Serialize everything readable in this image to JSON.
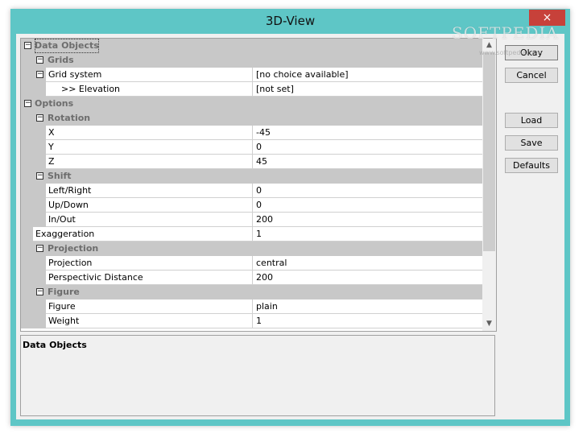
{
  "window": {
    "title": "3D-View",
    "close_icon": "×"
  },
  "grid": {
    "rows": [
      {
        "kind": "cat",
        "level": 0,
        "label": "Data Objects",
        "selected": true
      },
      {
        "kind": "cat",
        "level": 1,
        "label": "Grids"
      },
      {
        "kind": "prop",
        "level": 1,
        "expander": true,
        "name": "Grid system",
        "value": "[no choice available]"
      },
      {
        "kind": "prop",
        "level": 2,
        "name": ">> Elevation",
        "value": "[not set]"
      },
      {
        "kind": "cat",
        "level": 0,
        "label": "Options"
      },
      {
        "kind": "cat",
        "level": 1,
        "label": "Rotation"
      },
      {
        "kind": "prop",
        "level": 1,
        "name": "X",
        "value": "-45"
      },
      {
        "kind": "prop",
        "level": 1,
        "name": "Y",
        "value": "0"
      },
      {
        "kind": "prop",
        "level": 1,
        "name": "Z",
        "value": "45"
      },
      {
        "kind": "cat",
        "level": 1,
        "label": "Shift"
      },
      {
        "kind": "prop",
        "level": 1,
        "name": "Left/Right",
        "value": "0"
      },
      {
        "kind": "prop",
        "level": 1,
        "name": "Up/Down",
        "value": "0"
      },
      {
        "kind": "prop",
        "level": 1,
        "name": "In/Out",
        "value": "200"
      },
      {
        "kind": "prop",
        "level": 0,
        "name": "Exaggeration",
        "value": "1"
      },
      {
        "kind": "cat",
        "level": 1,
        "label": "Projection"
      },
      {
        "kind": "prop",
        "level": 1,
        "name": "Projection",
        "value": "central"
      },
      {
        "kind": "prop",
        "level": 1,
        "name": "Perspectivic Distance",
        "value": "200"
      },
      {
        "kind": "cat",
        "level": 1,
        "label": "Figure"
      },
      {
        "kind": "prop",
        "level": 1,
        "name": "Figure",
        "value": "plain"
      },
      {
        "kind": "prop",
        "level": 1,
        "name": "Weight",
        "value": "1"
      }
    ],
    "expander_glyph": "−",
    "scroll_up_icon": "▲",
    "scroll_down_icon": "▼"
  },
  "description": {
    "title": "Data Objects"
  },
  "buttons": {
    "okay": "Okay",
    "cancel": "Cancel",
    "load": "Load",
    "save": "Save",
    "defaults": "Defaults"
  },
  "watermark": {
    "main": "SOFTPEDIA",
    "sub": "www.softpedia.com"
  }
}
